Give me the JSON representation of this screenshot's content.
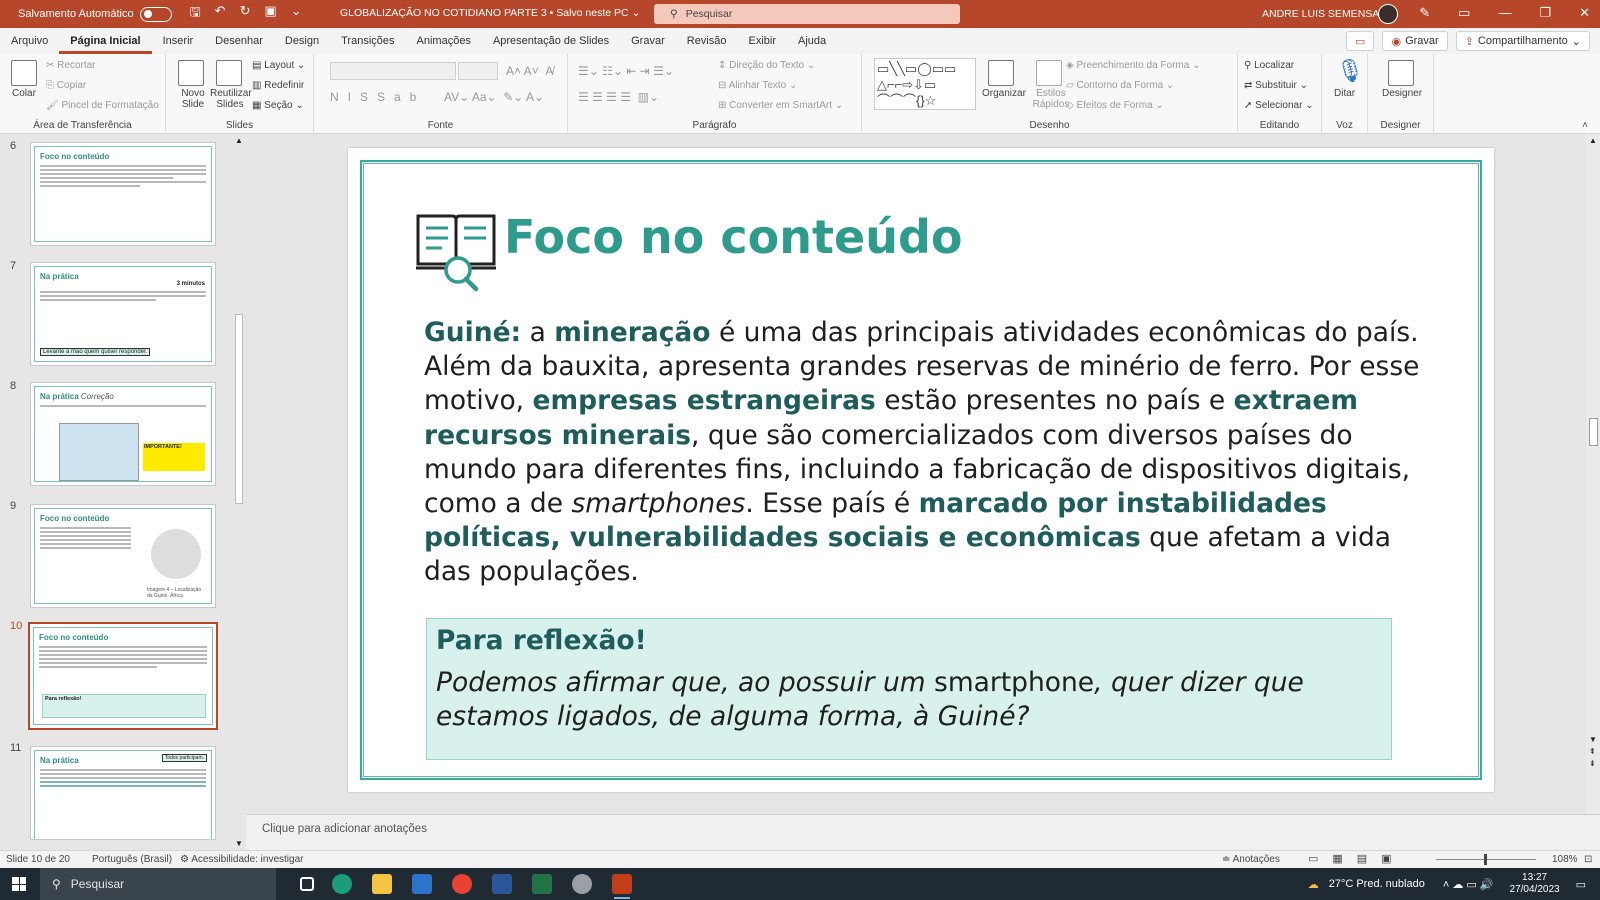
{
  "titlebar": {
    "autosave_label": "Salvamento Automático",
    "document": "GLOBALIZAÇÃO NO COTIDIANO PARTE 3 • Salvo neste PC ⌄",
    "search_placeholder": "Pesquisar",
    "user": "ANDRE LUIS SEMENSATO"
  },
  "menu": {
    "tabs": [
      "Arquivo",
      "Página Inicial",
      "Inserir",
      "Desenhar",
      "Design",
      "Transições",
      "Animações",
      "Apresentação de Slides",
      "Gravar",
      "Revisão",
      "Exibir",
      "Ajuda"
    ],
    "record_label": "Gravar",
    "share_label": "Compartilhamento"
  },
  "ribbon": {
    "clipboard": {
      "paste": "Colar",
      "cut": "Recortar",
      "copy": "Copiar",
      "format_painter": "Pincel de Formatação",
      "label": "Área de Transferência"
    },
    "slides": {
      "new_slide": "Novo Slide",
      "reuse": "Reutilizar Slides",
      "layout": "Layout",
      "reset": "Redefinir",
      "section": "Seção",
      "label": "Slides"
    },
    "font": {
      "label": "Fonte"
    },
    "paragraph": {
      "text_direction": "Direção do Texto",
      "align_text": "Alinhar Texto",
      "smartart": "Converter em SmartArt",
      "label": "Parágrafo"
    },
    "drawing": {
      "arrange": "Organizar",
      "quick_styles": "Estilos Rápidos",
      "fill": "Preenchimento da Forma",
      "outline": "Contorno da Forma",
      "effects": "Efeitos de Forma",
      "label": "Desenho"
    },
    "editing": {
      "find": "Localizar",
      "replace": "Substituir",
      "select": "Selecionar",
      "label": "Editando"
    },
    "voice": {
      "dictate": "Ditar",
      "label": "Voz"
    },
    "designer": {
      "designer": "Designer",
      "label": "Designer"
    }
  },
  "thumbnails": [
    {
      "num": "6",
      "title": "Foco no conteúdo"
    },
    {
      "num": "7",
      "title": "Na prática",
      "extra": "3 minutos",
      "footer": "Levante a mão quem quiser responder."
    },
    {
      "num": "8",
      "title": "Na prática",
      "subtitle": "Correção",
      "box": "IMPORTANTE!"
    },
    {
      "num": "9",
      "title": "Foco no conteúdo",
      "caption": "Imagem 4 – Localização da Guiné, África"
    },
    {
      "num": "10",
      "title": "Foco no conteúdo",
      "box": "Para reflexão!"
    },
    {
      "num": "11",
      "title": "Na prática",
      "badge": "Todos participam."
    }
  ],
  "slide": {
    "title": "Foco no conteúdo",
    "body": {
      "p1_bold": "Guiné:",
      "p1_text1": " a ",
      "p1_bold2": "mineração",
      "p1_text2": " é uma das principais atividades econômicas do país. Além da bauxita, apresenta grandes reservas de minério de ferro. Por esse motivo, ",
      "p1_bold3": "empresas estrangeiras",
      "p1_text3": " estão presentes no país e ",
      "p1_bold4": "extraem recursos minerais",
      "p1_text4": ", que são comercializados com diversos países do mundo para diferentes fins, incluindo a fabricação de dispositivos digitais, como a de ",
      "p1_italic": "smartphones",
      "p1_text5": ". Esse país é ",
      "p1_bold5": "marcado por instabilidades políticas, vulnerabilidades sociais e econômicas",
      "p1_text6": " que afetam a vida das populações."
    },
    "reflection": {
      "title": "Para reflexão!",
      "text1": "Podemos afirmar que, ao possuir um ",
      "text_normal": "smartphone",
      "text2": ", quer dizer que estamos ligados, de alguma forma, à Guiné?"
    }
  },
  "notes_placeholder": "Clique para adicionar anotações",
  "statusbar": {
    "slide_count": "Slide 10 de 20",
    "language": "Português (Brasil)",
    "accessibility": "Acessibilidade: investigar",
    "notes": "Anotações",
    "zoom": "108%"
  },
  "taskbar": {
    "search": "Pesquisar",
    "weather": "27°C  Pred. nublado",
    "time": "13:27",
    "date": "27/04/2023"
  },
  "colors": {
    "accent": "#b7472a",
    "teal": "#2e9b8c",
    "dark_teal": "#1f5d5d",
    "reflection_bg": "#d9f1ec"
  }
}
